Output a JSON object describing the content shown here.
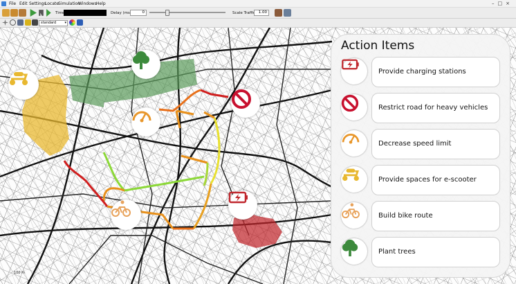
{
  "menubar": {
    "items": [
      "File",
      "Edit",
      "Settings",
      "Locate",
      "Simulation",
      "Windows",
      "Help"
    ]
  },
  "toolbar": {
    "time_label": "Time:",
    "delay_label": "Delay (ms):",
    "delay_value": "0",
    "scale_label": "Scale Traffic:",
    "scale_value": "1.00"
  },
  "viewbar": {
    "scheme": "standard"
  },
  "map": {
    "scale_text": "100 m"
  },
  "panel": {
    "title": "Action Items",
    "items": [
      {
        "label": "Provide charging stations",
        "icon": "battery-charging-icon"
      },
      {
        "label": "Restrict road for heavy vehicles",
        "icon": "no-entry-icon"
      },
      {
        "label": "Decrease speed limit",
        "icon": "speedometer-icon"
      },
      {
        "label": "Provide spaces for e-scooter",
        "icon": "scooter-icon"
      },
      {
        "label": "Build bike route",
        "icon": "bicycle-icon"
      },
      {
        "label": "Plant trees",
        "icon": "tree-icon"
      }
    ]
  },
  "colors": {
    "charging": "#c0272d",
    "restrict": "#c8102e",
    "speed": "#e8962a",
    "scooter": "#e8b830",
    "bike": "#e8a25a",
    "tree": "#3c8a3c"
  }
}
